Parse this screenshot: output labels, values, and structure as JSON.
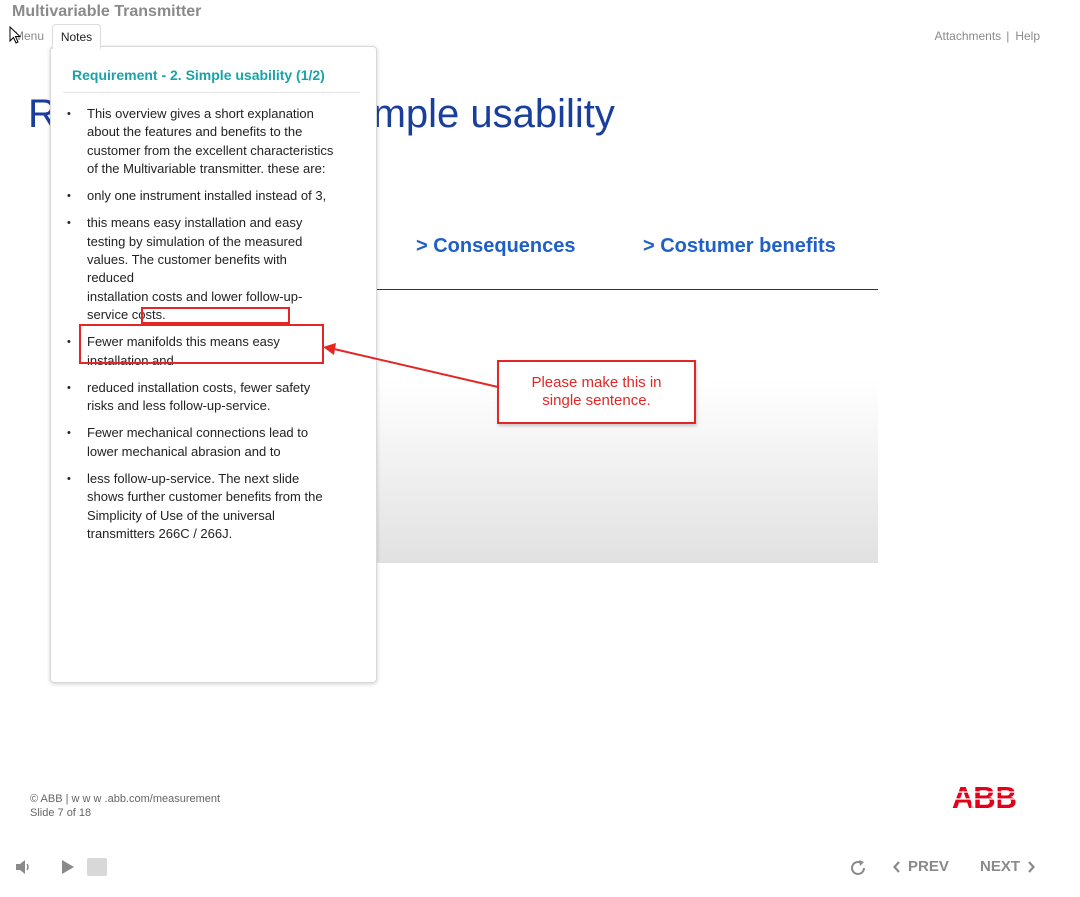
{
  "header": {
    "app_title": "Multivariable Transmitter",
    "menu_tab": "Menu",
    "notes_tab": "Notes",
    "attachments": "Attachments",
    "separator": "|",
    "help": "Help"
  },
  "slide": {
    "title": "Requirement - 2. Simple usability",
    "tabs": [
      "> Consequences",
      "> Costumer benefits"
    ]
  },
  "notes": {
    "heading": "Requirement - 2. Simple usability (1/2)",
    "items": [
      "This overview gives a short explanation about the features and benefits to the customer from the excellent characteristics of the Multivariable transmitter. these are:",
      "only one instrument installed instead of 3,",
      "this means easy installation and easy testing by simulation of the measured values. The customer benefits with reduced",
      "installation costs and lower follow-up-service costs.",
      "Fewer manifolds this means easy installation and",
      "reduced installation costs, fewer safety risks and less follow-up-service.",
      "Fewer mechanical connections lead to lower mechanical abrasion and to",
      "less follow-up-service. The next slide shows further customer benefits from the Simplicity of Use of the universal transmitters 266C / 266J."
    ]
  },
  "annotation": {
    "callout_text": "Please make this in single sentence.",
    "color": "#e32626"
  },
  "footer": {
    "copyright": "© ABB | w w w .abb.com/measurement",
    "slide_counter": "Slide 7 of 18",
    "logo_text": "ABB",
    "logo_color": "#e2001a"
  },
  "player": {
    "prev_label": "PREV",
    "next_label": "NEXT",
    "icons": [
      "volume-icon",
      "play-icon",
      "stop-icon",
      "replay-icon",
      "chevron-left-icon",
      "chevron-right-icon"
    ]
  }
}
